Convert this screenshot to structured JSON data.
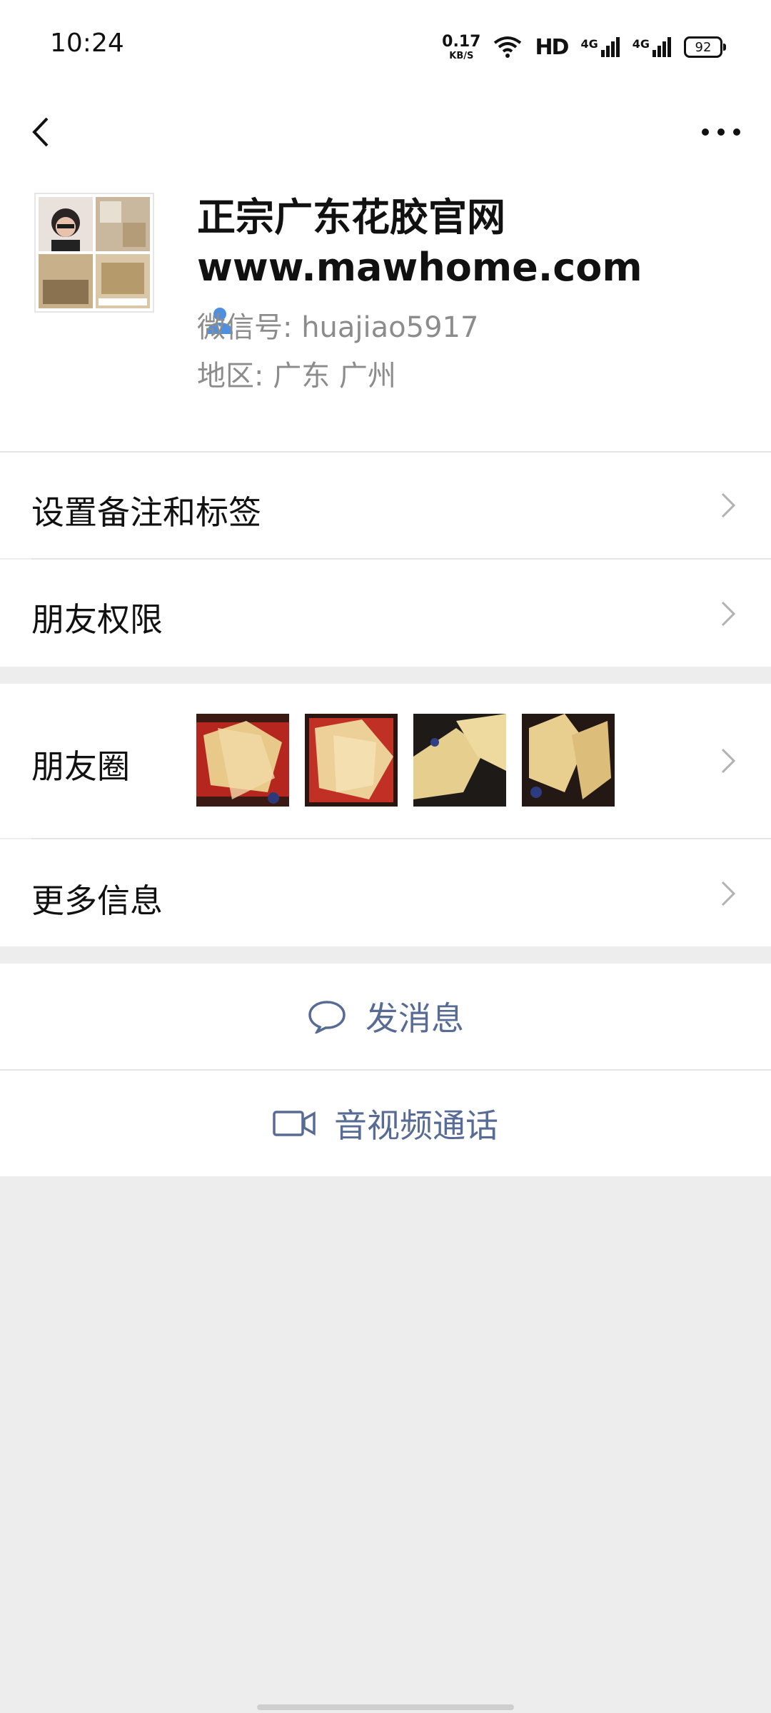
{
  "status_bar": {
    "time": "10:24",
    "net_speed_value": "0.17",
    "net_speed_unit": "KB/S",
    "hd_label": "HD",
    "signal_1_label": "4G",
    "signal_2_label": "4G",
    "battery_level": "92",
    "icons": [
      "wifi-icon",
      "signal-icon",
      "battery-icon"
    ]
  },
  "nav": {
    "back_icon": "back-chevron-icon",
    "more_icon": "more-dots-icon"
  },
  "profile": {
    "name": "正宗广东花胶官网 www.mawhome.com",
    "wechat_id": "微信号: huajiao5917",
    "region": "地区: 广东  广州",
    "verify_icon": "contact-person-icon",
    "verify_color": "#4f8fe0"
  },
  "rows": {
    "remark_label": "设置备注和标签",
    "permission_label": "朋友权限",
    "moments_label": "朋友圈",
    "more_info_label": "更多信息"
  },
  "actions": {
    "message_label": "发消息",
    "call_label": "音视频通话",
    "accent_color": "#576b95"
  }
}
